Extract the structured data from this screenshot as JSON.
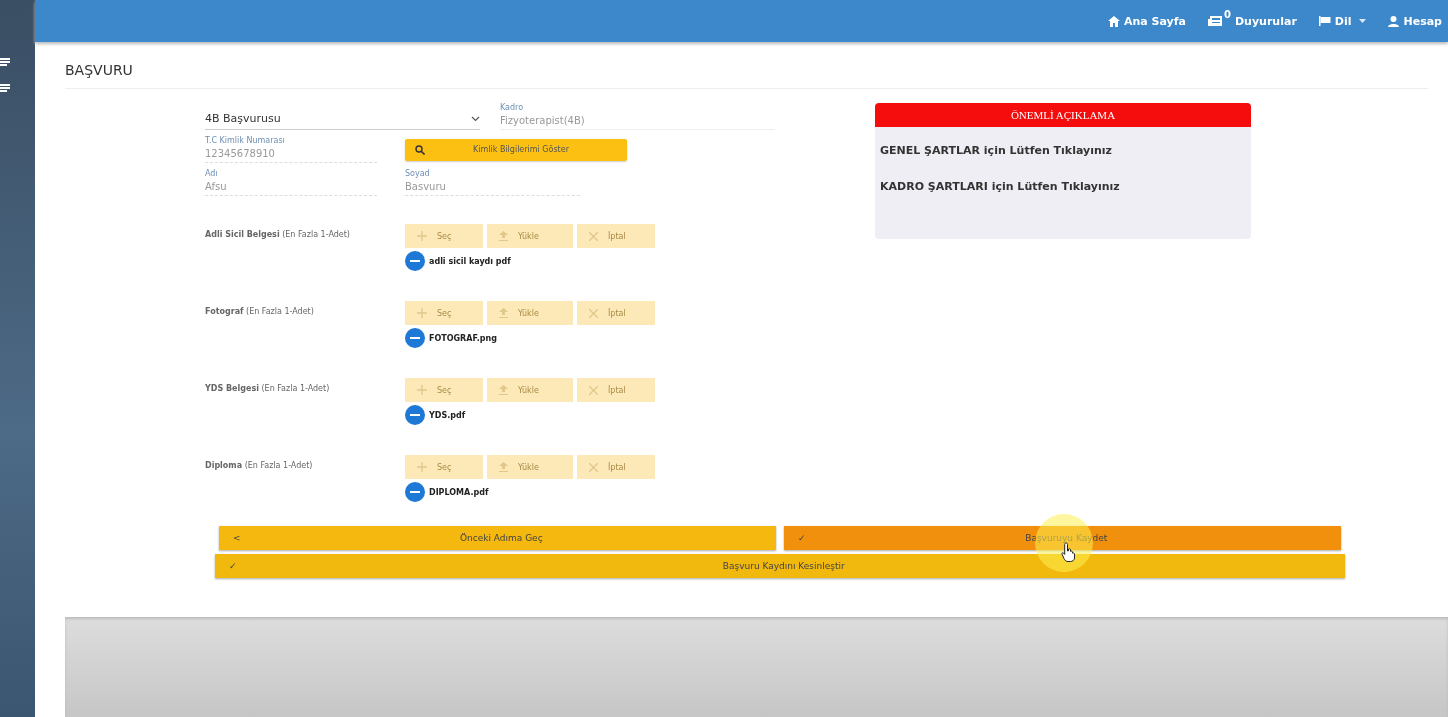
{
  "topbar": {
    "items": [
      {
        "kind": "home",
        "label": "Ana Sayfa"
      },
      {
        "kind": "news",
        "label": "Duyurular",
        "badge": "0"
      },
      {
        "kind": "flag",
        "label": "Dil",
        "dropdown": true
      },
      {
        "kind": "user",
        "label": "Hesap"
      }
    ]
  },
  "page_title": "BAŞVURU",
  "form": {
    "type_select": {
      "value": "4B Başvurusu"
    },
    "kadro": {
      "label": "Kadro",
      "value": "Fizyoterapist(4B)"
    },
    "tc": {
      "label": "T.C Kimlik Numarası",
      "value": "12345678910"
    },
    "lookup_button": "Kimlik Bilgilerimi Göster",
    "ad": {
      "label": "Adı",
      "value": "Afsu"
    },
    "soyad": {
      "label": "Soyad",
      "value": "Basvuru"
    }
  },
  "documents": [
    {
      "label": "**Adli Sicil Belgesi** (En Fazla 1-Adet)",
      "buttons": [
        {
          "kind": "add",
          "label": "Seç",
          "disabled": true
        },
        {
          "kind": "upload",
          "label": "Yükle",
          "disabled": true
        },
        {
          "kind": "cancel",
          "label": "İptal",
          "disabled": true
        }
      ],
      "file": "adli sicil kaydı pdf"
    },
    {
      "label": "**Fotograf** (En Fazla 1-Adet)",
      "buttons": [
        {
          "kind": "add",
          "label": "Seç",
          "disabled": true
        },
        {
          "kind": "upload",
          "label": "Yükle",
          "disabled": true
        },
        {
          "kind": "cancel",
          "label": "İptal",
          "disabled": true
        }
      ],
      "file": "FOTOGRAF.png"
    },
    {
      "label": "**YDS Belgesi** (En Fazla 1-Adet)",
      "buttons": [
        {
          "kind": "add",
          "label": "Seç",
          "disabled": true
        },
        {
          "kind": "upload",
          "label": "Yükle",
          "disabled": true
        },
        {
          "kind": "cancel",
          "label": "İptal",
          "disabled": true
        }
      ],
      "file": "YDS.pdf"
    },
    {
      "label": "**Diploma** (En Fazla 1-Adet)",
      "buttons": [
        {
          "kind": "add",
          "label": "Seç",
          "disabled": true
        },
        {
          "kind": "upload",
          "label": "Yükle",
          "disabled": true
        },
        {
          "kind": "cancel",
          "label": "İptal",
          "disabled": true
        }
      ],
      "file": "DIPLOMA.pdf"
    }
  ],
  "notice": {
    "title": "ÖNEMLİ AÇIKLAMA",
    "links": [
      "GENEL ŞARTLAR için Lütfen Tıklayınız",
      "KADRO ŞARTLARI için Lütfen Tıklayınız"
    ]
  },
  "actions": {
    "prev": {
      "icon": "<",
      "label": "Önceki Adıma Geç"
    },
    "save": {
      "icon": "✓",
      "label": "Başvuruyu Kaydet"
    },
    "finalize": {
      "icon": "✓",
      "label": "Başvuru Kaydını Kesinleştir"
    }
  }
}
